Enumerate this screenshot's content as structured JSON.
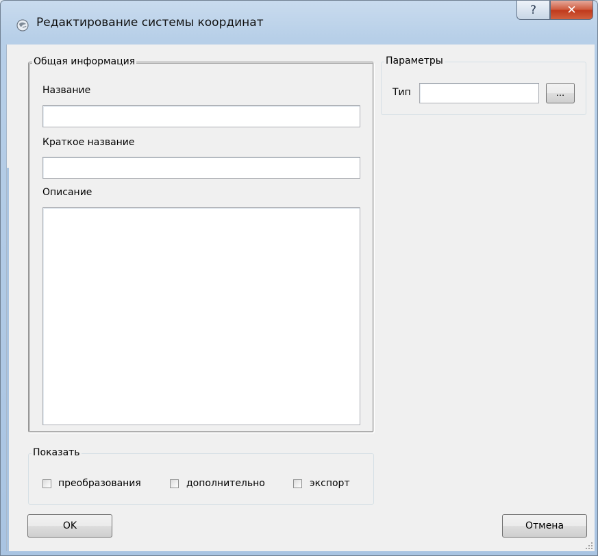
{
  "window": {
    "title": "Редактирование системы координат",
    "help_glyph": "?",
    "close_glyph": "✕"
  },
  "general": {
    "legend": "Общая информация",
    "name_label": "Название",
    "name_value": "",
    "short_name_label": "Краткое название",
    "short_name_value": "",
    "description_label": "Описание",
    "description_value": ""
  },
  "params": {
    "legend": "Параметры",
    "type_label": "Тип",
    "type_value": "",
    "browse_label": "..."
  },
  "show": {
    "legend": "Показать",
    "options": [
      {
        "label": "преобразования",
        "checked": false
      },
      {
        "label": "дополнительно",
        "checked": false
      },
      {
        "label": "экспорт",
        "checked": false
      }
    ]
  },
  "buttons": {
    "ok": "OK",
    "cancel": "Отмена"
  },
  "colors": {
    "accent": "#3c7fb1",
    "client_bg": "#f0f0f0",
    "close_red": "#c0391c"
  }
}
